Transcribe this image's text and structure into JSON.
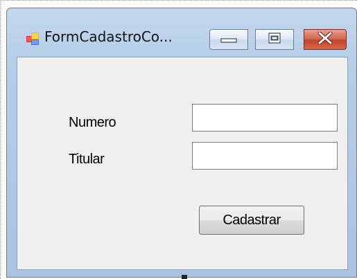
{
  "window": {
    "title": "FormCadastroCo...",
    "icon": "form-app-icon",
    "controls": {
      "minimize_icon": "minimize-icon",
      "maximize_icon": "maximize-icon",
      "close_icon": "close-icon"
    }
  },
  "form": {
    "numero_label": "Numero",
    "numero_value": "",
    "titular_label": "Titular",
    "titular_value": "",
    "submit_label": "Cadastrar"
  },
  "colors": {
    "title_bar": "#b9d1ea",
    "client_area": "#f0f0f0",
    "close_button": "#c9452c"
  }
}
